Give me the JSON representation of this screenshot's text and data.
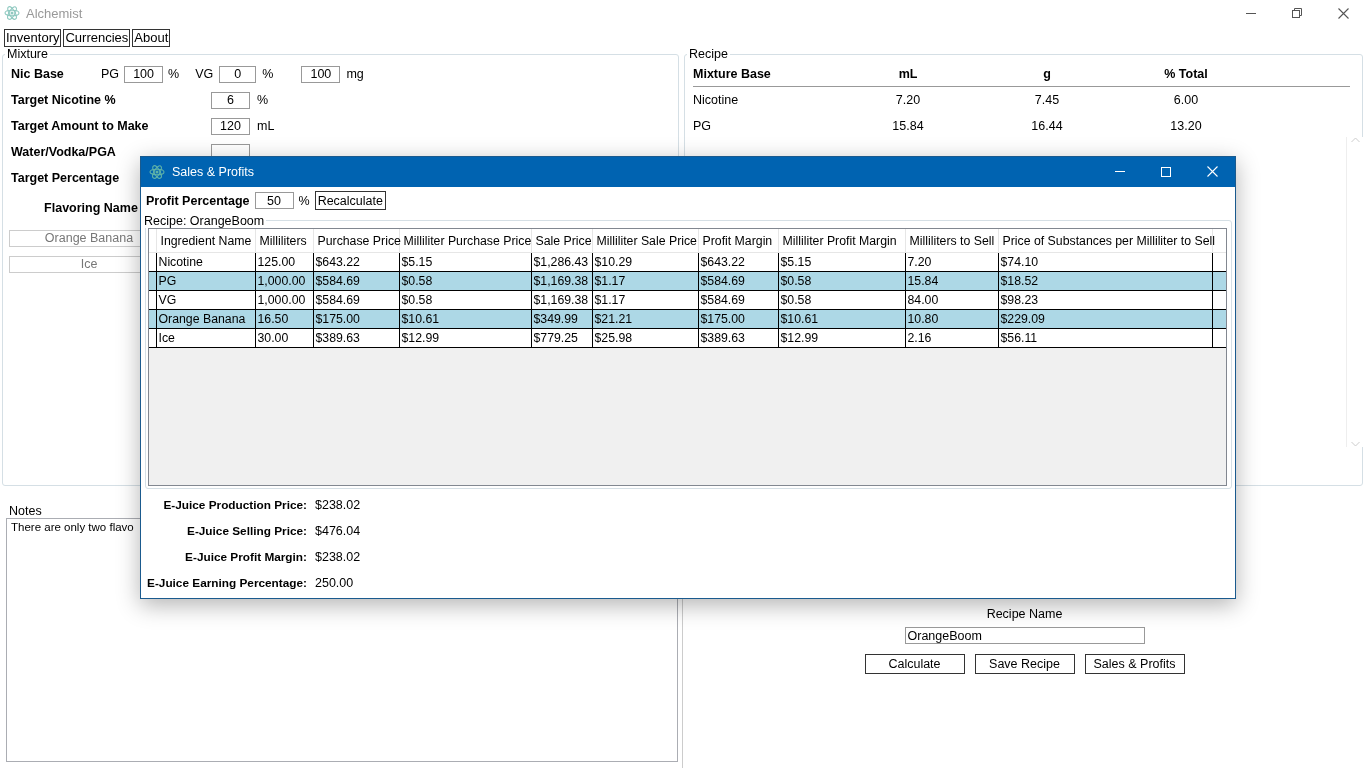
{
  "window": {
    "title": "Alchemist"
  },
  "menu": [
    "Inventory",
    "Currencies",
    "About"
  ],
  "mixture": {
    "title": "Mixture",
    "nic_base": {
      "label": "Nic Base",
      "pg_label": "PG",
      "pg_value": "100",
      "pg_unit": "%",
      "vg_label": "VG",
      "vg_value": "0",
      "vg_unit": "%",
      "strength_value": "100",
      "strength_unit": "mg"
    },
    "fields": [
      {
        "kind": "field",
        "label": "Target Nicotine %",
        "value": "6",
        "unit": "%"
      },
      {
        "kind": "field",
        "label": "Target Amount to Make",
        "value": "120",
        "unit": "mL"
      },
      {
        "kind": "field",
        "label": "Water/Vodka/PGA"
      },
      {
        "kind": "label",
        "label": "Target Percentage"
      }
    ],
    "flavorings": {
      "header": "Flavoring Name",
      "items": [
        "Orange Banana",
        "Ice"
      ]
    }
  },
  "notes": {
    "title": "Notes",
    "text": "There are only two flavo"
  },
  "recipe": {
    "title": "Recipe",
    "columns": [
      "Mixture Base",
      "mL",
      "g",
      "% Total"
    ],
    "rows": [
      [
        "Nicotine",
        "7.20",
        "7.45",
        "6.00"
      ],
      [
        "PG",
        "15.84",
        "16.44",
        "13.20"
      ]
    ]
  },
  "recipe_name": {
    "label": "Recipe Name",
    "value": "OrangeBoom"
  },
  "actions": [
    "Calculate",
    "Save Recipe",
    "Sales & Profits"
  ],
  "dialog": {
    "title": "Sales & Profits",
    "profit": {
      "label": "Profit Percentage",
      "value": "50",
      "unit": "%",
      "button": "Recalculate"
    },
    "group_title": "Recipe: OrangeBoom",
    "columns": [
      "Ingredient Name",
      "Milliliters",
      "Purchase Price",
      "Milliliter Purchase Price",
      "Sale Price",
      "Milliliter Sale Price",
      "Profit Margin",
      "Milliliter Profit Margin",
      "Milliliters to Sell",
      "Price of Substances per Milliliter to Sell"
    ],
    "rows": [
      {
        "selected": false,
        "cells": [
          "Nicotine",
          "125.00",
          "$643.22",
          "$5.15",
          "$1,286.43",
          "$10.29",
          "$643.22",
          "$5.15",
          "7.20",
          "$74.10"
        ]
      },
      {
        "selected": true,
        "cells": [
          "PG",
          "1,000.00",
          "$584.69",
          "$0.58",
          "$1,169.38",
          "$1.17",
          "$584.69",
          "$0.58",
          "15.84",
          "$18.52"
        ]
      },
      {
        "selected": false,
        "cells": [
          "VG",
          "1,000.00",
          "$584.69",
          "$0.58",
          "$1,169.38",
          "$1.17",
          "$584.69",
          "$0.58",
          "84.00",
          "$98.23"
        ]
      },
      {
        "selected": true,
        "cells": [
          "Orange Banana",
          "16.50",
          "$175.00",
          "$10.61",
          "$349.99",
          "$21.21",
          "$175.00",
          "$10.61",
          "10.80",
          "$229.09"
        ]
      },
      {
        "selected": false,
        "cells": [
          "Ice",
          "30.00",
          "$389.63",
          "$12.99",
          "$779.25",
          "$25.98",
          "$389.63",
          "$12.99",
          "2.16",
          "$56.11"
        ]
      }
    ],
    "summary": [
      {
        "label": "E-Juice Production Price:",
        "value": "$238.02"
      },
      {
        "label": "E-Juice Selling Price:",
        "value": "$476.04"
      },
      {
        "label": "E-Juice Profit Margin:",
        "value": "$238.02"
      },
      {
        "label": "E-Juice Earning Percentage:",
        "value": "250.00"
      }
    ]
  }
}
